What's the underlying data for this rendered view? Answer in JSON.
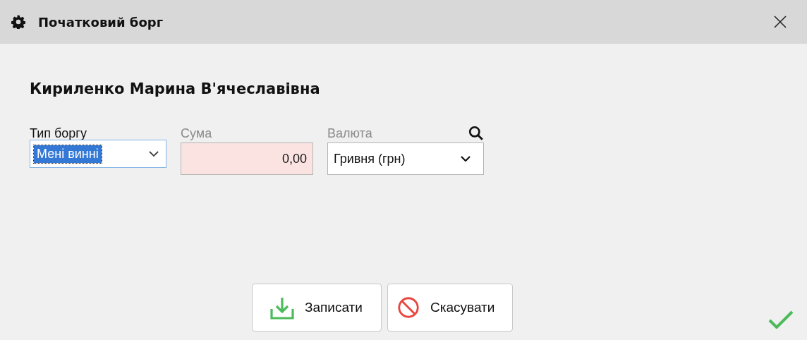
{
  "window": {
    "title": "Початковий борг"
  },
  "person": "Кириленко Марина В'ячеславівна",
  "fields": [
    {
      "kind": "dropdown",
      "label": "Тип боргу",
      "value": "Мені винні",
      "focused": true,
      "label_dimmed": false
    },
    {
      "kind": "amount",
      "label": "Сума",
      "value": "0,00",
      "invalid": true,
      "label_dimmed": true
    },
    {
      "kind": "lookup",
      "label": "Валюта",
      "value": "Гривня (грн)",
      "label_dimmed": true
    }
  ],
  "buttons": [
    {
      "kind": "save",
      "label": "Записати"
    },
    {
      "kind": "cancel",
      "label": "Скасувати"
    }
  ]
}
